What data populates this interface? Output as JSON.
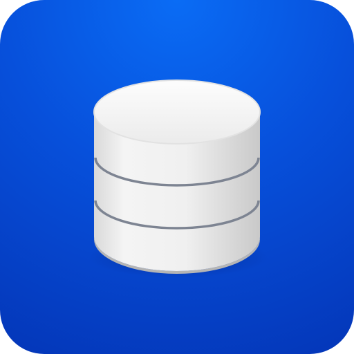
{
  "app_icon": {
    "name": "database-icon",
    "colors": {
      "background_top": "#0a6cf5",
      "background_bottom": "#0436b8",
      "cylinder_light": "#fafafa",
      "cylinder_mid": "#e6e6e6",
      "cylinder_dark": "#c8c8c8",
      "separator": "#7d8492"
    }
  }
}
